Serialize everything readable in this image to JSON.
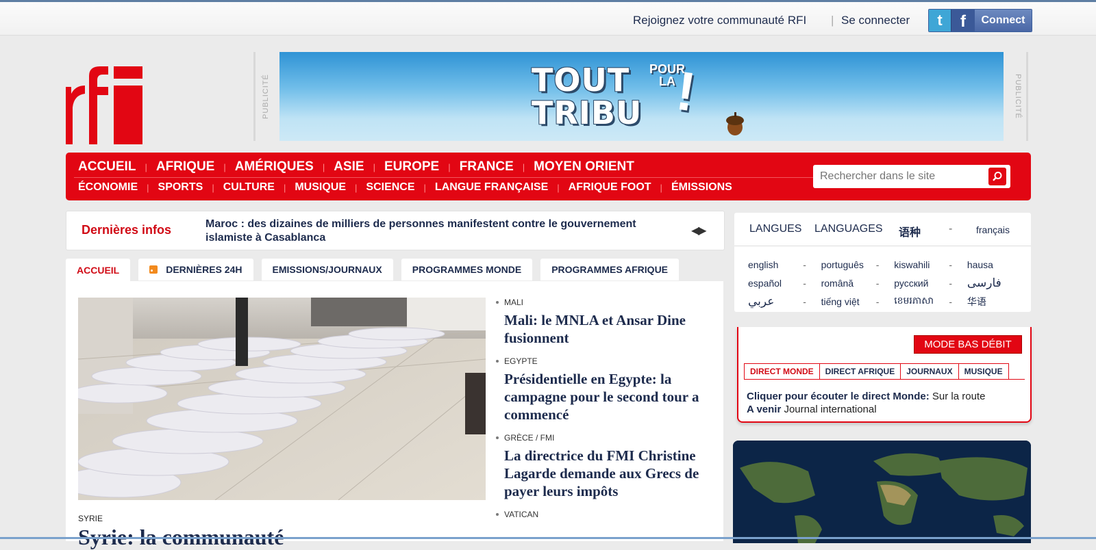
{
  "header": {
    "join_text": "Rejoignez votre communauté RFI",
    "separator": "|",
    "login_text": "Se connecter",
    "connect_label": "Connect",
    "twitter_glyph": "t",
    "facebook_glyph": "f"
  },
  "ad": {
    "label": "PUBLICITÉ",
    "line1": "TOUT",
    "line2": "TRIBU",
    "small1": "POUR",
    "small2": "LA",
    "exclaim": "!"
  },
  "nav": {
    "primary": [
      "ACCUEIL",
      "AFRIQUE",
      "AMÉRIQUES",
      "ASIE",
      "EUROPE",
      "FRANCE",
      "MOYEN ORIENT"
    ],
    "secondary": [
      "ÉCONOMIE",
      "SPORTS",
      "CULTURE",
      "MUSIQUE",
      "SCIENCE",
      "LANGUE FRANÇAISE",
      "AFRIQUE FOOT",
      "ÉMISSIONS"
    ],
    "search_placeholder": "Rechercher dans le site"
  },
  "breaking": {
    "title": "Dernières infos",
    "message": "Maroc : des dizaines de milliers de personnes manifestent contre le gouvernement islamiste à Casablanca",
    "arrows": "◀▶"
  },
  "tabs": [
    "ACCUEIL",
    "DERNIÈRES 24H",
    "EMISSIONS/JOURNAUX",
    "PROGRAMMES MONDE",
    "PROGRAMMES AFRIQUE"
  ],
  "lead": {
    "category": "SYRIE",
    "title": "Syrie: la communauté"
  },
  "stories": [
    {
      "category": "MALI",
      "title": "Mali: le MNLA et Ansar Dine fusionnent"
    },
    {
      "category": "EGYPTE",
      "title": "Présidentielle en Egypte: la campagne pour le second tour a commencé"
    },
    {
      "category": "GRÈCE / FMI",
      "title": "La directrice du FMI Christine Lagarde demande aux Grecs de payer leurs impôts"
    },
    {
      "category": "VATICAN",
      "title": ""
    }
  ],
  "languages": {
    "header_langues": "LANGUES",
    "header_languages": "LANGUAGES",
    "header_chinese": "语种",
    "header_dash": "-",
    "header_current": "français",
    "rows": [
      [
        "english",
        "português",
        "kiswahili",
        "hausa"
      ],
      [
        "español",
        "română",
        "русский",
        "فارسی"
      ],
      [
        "عربي",
        "tiếng việt",
        "ខេមរភាសា",
        "华语"
      ]
    ],
    "dash": "-"
  },
  "radio": {
    "mode_button": "MODE BAS DÉBIT",
    "tabs": [
      "DIRECT MONDE",
      "DIRECT AFRIQUE",
      "JOURNAUX",
      "MUSIQUE"
    ],
    "listen_label": "Cliquer pour écouter le direct Monde:",
    "listen_value": "Sur la route",
    "next_label": "A venir",
    "next_value": "Journal international"
  },
  "colors": {
    "brand_red": "#e20613",
    "navy_text": "#1d2b4d"
  }
}
